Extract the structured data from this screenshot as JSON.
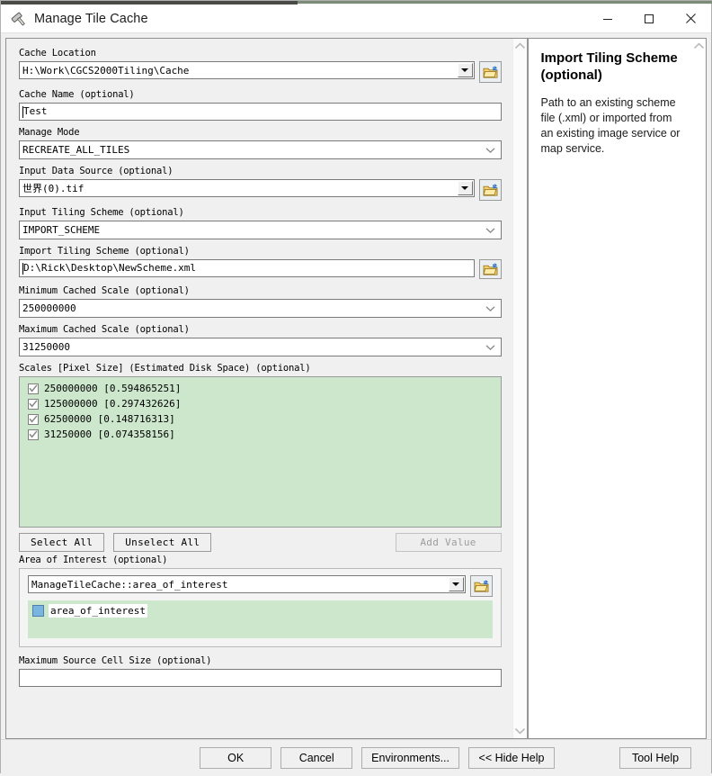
{
  "window": {
    "title": "Manage Tile Cache",
    "icon": "hammer-icon",
    "minimize": "—",
    "maximize": "□",
    "close": "✕"
  },
  "form": {
    "cache_location": {
      "label": "Cache Location",
      "value": "H:\\Work\\CGCS2000Tiling\\Cache",
      "control": "combo-3d-with-browse"
    },
    "cache_name": {
      "label": "Cache Name (optional)",
      "value": "Test",
      "control": "text"
    },
    "manage_mode": {
      "label": "Manage Mode",
      "value": "RECREATE_ALL_TILES",
      "control": "combo-flat"
    },
    "input_data_source": {
      "label": "Input Data Source (optional)",
      "value": "世界(0).tif",
      "control": "combo-3d-with-browse"
    },
    "input_tiling_scheme": {
      "label": "Input Tiling Scheme (optional)",
      "value": "IMPORT_SCHEME",
      "control": "combo-flat"
    },
    "import_tiling_scheme": {
      "label": "Import Tiling Scheme (optional)",
      "value": "D:\\Rick\\Desktop\\NewScheme.xml",
      "control": "text-with-browse"
    },
    "minimum_cached_scale": {
      "label": "Minimum Cached Scale (optional)",
      "value": "250000000",
      "control": "combo-flat"
    },
    "maximum_cached_scale": {
      "label": "Maximum Cached Scale (optional)",
      "value": "31250000",
      "control": "combo-flat"
    },
    "scales": {
      "label": "Scales [Pixel Size] (Estimated Disk Space) (optional)",
      "items": [
        {
          "checked": true,
          "text": "250000000 [0.594865251]"
        },
        {
          "checked": true,
          "text": "125000000 [0.297432626]"
        },
        {
          "checked": true,
          "text": "62500000 [0.148716313]"
        },
        {
          "checked": true,
          "text": "31250000 [0.074358156]"
        }
      ],
      "select_all": "Select All",
      "unselect_all": "Unselect All",
      "add_value": "Add Value",
      "add_value_enabled": false
    },
    "area_of_interest": {
      "label": "Area of Interest (optional)",
      "value": "ManageTileCache::area_of_interest",
      "items": [
        {
          "symbol": "polygon-symbol",
          "text": "area_of_interest"
        }
      ]
    },
    "maximum_source_cell_size": {
      "label": "Maximum Source Cell Size (optional)",
      "value": "",
      "control": "text"
    }
  },
  "help": {
    "title": "Import Tiling Scheme (optional)",
    "text": "Path to an existing scheme file (.xml) or imported from an existing image service or map service."
  },
  "footer": {
    "ok": "OK",
    "cancel": "Cancel",
    "environments": "Environments...",
    "hide_help": "<< Hide Help",
    "tool_help": "Tool Help"
  },
  "colors": {
    "list_background": "#cde7cd",
    "window_background": "#f0f0f0",
    "polygon_symbol": "#7ab4e0"
  }
}
